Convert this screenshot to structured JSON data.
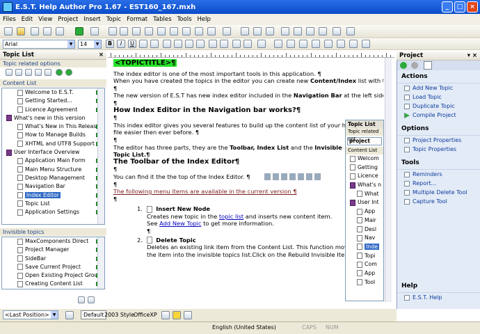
{
  "window": {
    "title": "E.S.T. Help Author Pro 1.67 - EST160_167.mxh"
  },
  "menu": [
    "Files",
    "Edit",
    "View",
    "Project",
    "Insert",
    "Topic",
    "Format",
    "Tables",
    "Tools",
    "Help"
  ],
  "format": {
    "font": "Arial",
    "size": "14"
  },
  "left": {
    "panel_title": "Topic List",
    "options_label": "Topic related options",
    "content_label": "Content List",
    "content_items": [
      {
        "label": "Welcome to E.S.T.",
        "level": 1,
        "icon": "page"
      },
      {
        "label": "Getting Started...",
        "level": 1,
        "icon": "page"
      },
      {
        "label": "Licence Agreement",
        "level": 1,
        "icon": "page"
      },
      {
        "label": "What's new in this version",
        "level": 0,
        "icon": "book"
      },
      {
        "label": "What's New in This Release",
        "level": 1,
        "icon": "page"
      },
      {
        "label": "How to Manage Builds",
        "level": 1,
        "icon": "page"
      },
      {
        "label": "XHTML and UTF8 Support",
        "level": 1,
        "icon": "page"
      },
      {
        "label": "User Interface Overview",
        "level": 0,
        "icon": "book"
      },
      {
        "label": "Application Main Form",
        "level": 1,
        "icon": "page"
      },
      {
        "label": "Main Menu Structure",
        "level": 1,
        "icon": "page"
      },
      {
        "label": "Desktop Management",
        "level": 1,
        "icon": "page"
      },
      {
        "label": "Navigation Bar",
        "level": 1,
        "icon": "page"
      },
      {
        "label": "Index Editor",
        "level": 1,
        "icon": "page",
        "selected": true
      },
      {
        "label": "Topic List",
        "level": 1,
        "icon": "page"
      },
      {
        "label": "Application Settings",
        "level": 1,
        "icon": "page"
      }
    ],
    "invisible_label": "Invisible topics",
    "invisible_items": [
      "MaxComponents Direct",
      "Project Manager",
      "SideBar",
      "Save Current Project",
      "Open Existing Project Group",
      "Creating Content List"
    ]
  },
  "editor": {
    "topic_title": "<TOPICTITLE>¶",
    "p1": "The index editor is one of the most important tools in this application. ¶",
    "p2a": "When you have created the topics in the editor you can create new ",
    "p2b": "Content/Index",
    "p2c": " list with this too",
    "pilcrow": "¶",
    "p3a": "The new version of E.S.T has new index editor included in the ",
    "p3b": "Navigation Bar",
    "p3c": " at the left side of the",
    "h1": "How Index Editor in the Navigation bar works?¶",
    "p4a": "This index editor gives you several features to build up the content list of your help",
    "p4b": "file easier then ever before. ¶",
    "p5a": "The editor has three parts, they are the ",
    "p5b": "Toolbar, Index List",
    "p5c": " and the ",
    "p5d": "Invisible",
    "p5e": "Topic List.¶",
    "h2": "The Toolbar of the Index Editor¶",
    "p6": "You can find it the the top of the Index Editor. ¶",
    "p7": "The following menu items are available in the current version ¶",
    "li1_num": "1.",
    "li1_title": "Insert New Node",
    "li1a": "Creates new topic in the ",
    "li1_link": "topic list",
    "li1b": " and inserts new content item.",
    "li1c": "See ",
    "li1_link2": "Add New Topic",
    "li1d": " to get more information.",
    "li2_num": "2.",
    "li2_title": "Delete Topic",
    "li2a": "Deletes an existing link item from the Content List. This function moves",
    "li2b": "the item into the invisible topics list.Click on the Rebuild Invisible Items"
  },
  "subwin": {
    "title": "Topic List",
    "opts": "Topic related opt",
    "project": "project",
    "content": "Content List",
    "items": [
      "Welcom",
      "Getting",
      "Licence",
      "What's n",
      "What",
      "User Int",
      "App",
      "Mair",
      "Desl",
      "Nav",
      "Inde",
      "Topi",
      "Com",
      "App",
      "Tool"
    ]
  },
  "right": {
    "title": "Project",
    "actions_h": "Actions",
    "actions": [
      "Add New Topic",
      "Load Topic",
      "Duplicate Topic",
      "Compile Project"
    ],
    "options_h": "Options",
    "options": [
      "Project Properties",
      "Topic Properties"
    ],
    "tools_h": "Tools",
    "tools": [
      "Reminders",
      "Report...",
      "Multiple Delete Tool",
      "Capture Tool"
    ],
    "help_h": "Help",
    "help": [
      "E.S.T. Help"
    ]
  },
  "bottom": {
    "position": "<Last Position>",
    "default": "Default",
    "style2003": "2003 Style",
    "officexp": "OfficeXP"
  },
  "status": {
    "lang": "English (United States)",
    "caps": "CAPS",
    "num": "NUM"
  }
}
